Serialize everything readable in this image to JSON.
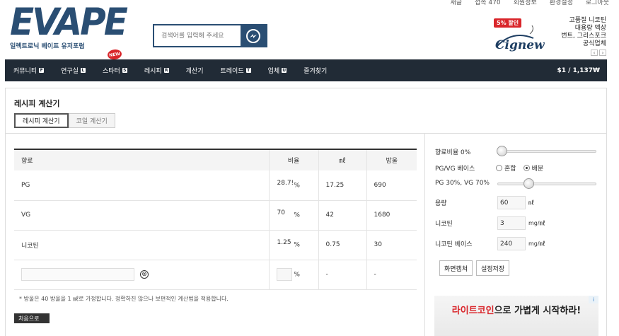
{
  "topbar": {
    "links": [
      "새글",
      "접속 470",
      "회원정보",
      "환경설정",
      "로그아웃"
    ]
  },
  "logo": {
    "word": "EVAPE",
    "sub": "일렉트로닉 베이프 유저포럼"
  },
  "search": {
    "placeholder": "검색어를 입력해 주세요"
  },
  "ad": {
    "badge": "5% 할인",
    "brand": "Cignew",
    "lines": [
      "고품질 니코틴",
      "대용량 액상",
      "번트, 그리스포크",
      "공식업체"
    ],
    "prev": "‹",
    "next": "›"
  },
  "nav": {
    "new_badge": "NEW",
    "items": [
      {
        "label": "커뮤니티",
        "tag": "F"
      },
      {
        "label": "연구실",
        "tag": "L"
      },
      {
        "label": "스타터",
        "tag": "S"
      },
      {
        "label": "레시피",
        "tag": "R"
      },
      {
        "label": "계산기",
        "tag": ""
      },
      {
        "label": "트레이드",
        "tag": "T"
      },
      {
        "label": "업체",
        "tag": "U"
      },
      {
        "label": "즐겨찾기",
        "tag": ""
      }
    ],
    "rate": "$1 / 1,137₩"
  },
  "page": {
    "title": "레시피 계산기",
    "tabs": [
      "레시피 계산기",
      "코일 계산기"
    ]
  },
  "table": {
    "headers": [
      "향료",
      "비율",
      "㎖",
      "방울"
    ],
    "rows": [
      {
        "name": "PG",
        "ratio": "28.7!",
        "unit": "%",
        "ml": "17.25",
        "drops": "690"
      },
      {
        "name": "VG",
        "ratio": "70",
        "unit": "%",
        "ml": "42",
        "drops": "1680"
      },
      {
        "name": "니코틴",
        "ratio": "1.25",
        "unit": "%",
        "ml": "0.75",
        "drops": "30"
      }
    ],
    "empty_row": {
      "unit": "%",
      "ml": "-",
      "drops": "-"
    },
    "clear_icon": "⊗",
    "note": "* 방울은 40 방울을 1 ㎖로 가정합니다. 정확하진 않으나 보편적인 계산법을 적용합니다.",
    "reset": "처음으로"
  },
  "settings": {
    "flavor_label": "향료비율 0%",
    "flavor_value": 0,
    "base_label": "PG/VG 베이스",
    "base_options": [
      "혼합",
      "배분"
    ],
    "base_selected": "배분",
    "pgvg_label": "PG 30%, VG 70%",
    "pgvg_value": 0.3,
    "volume_label": "용량",
    "volume_value": "60",
    "volume_unit": "㎖",
    "nic_label": "니코틴",
    "nic_value": "3",
    "nic_unit": "mg/㎖",
    "nicbase_label": "니코틴 베이스",
    "nicbase_value": "240",
    "nicbase_unit": "mg/㎖",
    "btn_capture": "화면캡쳐",
    "btn_save": "설정저장"
  },
  "banner": {
    "highlight": "라이트코인",
    "text": "으로 가볍게 시작하라!",
    "adchoice": "i"
  }
}
